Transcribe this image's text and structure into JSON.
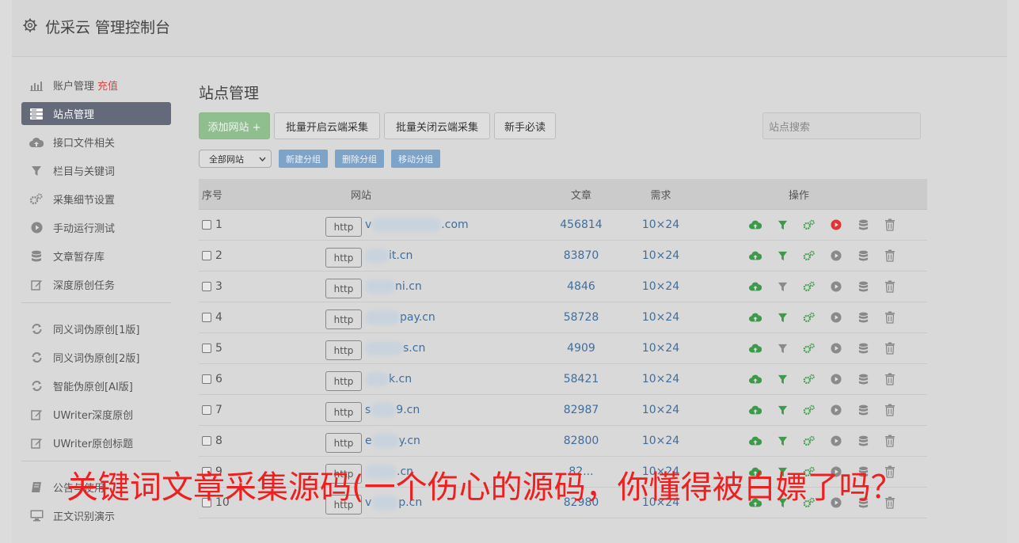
{
  "app": {
    "title": "优采云 管理控制台"
  },
  "sidebar": {
    "items": [
      {
        "label": "账户管理",
        "badge": "充值",
        "icon": "bar-chart-icon"
      },
      {
        "label": "站点管理",
        "icon": "server-icon",
        "active": true
      },
      {
        "label": "接口文件相关",
        "icon": "cloud-upload-icon"
      },
      {
        "label": "栏目与关键词",
        "icon": "filter-icon"
      },
      {
        "label": "采集细节设置",
        "icon": "gears-icon"
      },
      {
        "label": "手动运行测试",
        "icon": "play-circle-icon"
      },
      {
        "label": "文章暂存库",
        "icon": "database-icon"
      },
      {
        "label": "深度原创任务",
        "icon": "edit-icon"
      }
    ],
    "items2": [
      {
        "label": "同义词伪原创[1版]",
        "icon": "refresh-icon"
      },
      {
        "label": "同义词伪原创[2版]",
        "icon": "refresh-icon"
      },
      {
        "label": "智能伪原创[AI版]",
        "icon": "refresh-icon"
      },
      {
        "label": "UWriter深度原创",
        "icon": "edit-icon"
      },
      {
        "label": "UWriter原创标题",
        "icon": "edit-icon"
      }
    ],
    "items3": [
      {
        "label": "公告与使用",
        "icon": "book-icon"
      },
      {
        "label": "正文识别演示",
        "icon": "monitor-icon"
      }
    ]
  },
  "main": {
    "title": "站点管理",
    "buttons": {
      "add_site": "添加网站 +",
      "batch_enable": "批量开启云端采集",
      "batch_disable": "批量关闭云端采集",
      "beginner": "新手必读"
    },
    "search": {
      "placeholder": "站点搜索"
    },
    "group_select": "全部网站",
    "group_buttons": {
      "new": "新建分组",
      "delete": "删除分组",
      "move": "移动分组"
    },
    "table": {
      "headers": {
        "no": "序号",
        "site": "网站",
        "articles": "文章",
        "demand": "需求",
        "ops": "操作"
      },
      "rows": [
        {
          "no": "1",
          "proto": "http",
          "prefix": "v",
          "suffix": ".com",
          "articles": "456814",
          "demand": "10×24",
          "filter_on": true,
          "run_red": true
        },
        {
          "no": "2",
          "proto": "http",
          "prefix": "",
          "suffix": "it.cn",
          "articles": "83870",
          "demand": "10×24",
          "filter_on": true,
          "run_red": false
        },
        {
          "no": "3",
          "proto": "http",
          "prefix": "",
          "suffix": "ni.cn",
          "articles": "4846",
          "demand": "10×24",
          "filter_on": false,
          "run_red": false
        },
        {
          "no": "4",
          "proto": "http",
          "prefix": "",
          "suffix": "pay.cn",
          "articles": "58728",
          "demand": "10×24",
          "filter_on": true,
          "run_red": false
        },
        {
          "no": "5",
          "proto": "http",
          "prefix": "",
          "suffix": "s.cn",
          "articles": "4909",
          "demand": "10×24",
          "filter_on": false,
          "run_red": false
        },
        {
          "no": "6",
          "proto": "http",
          "prefix": "",
          "suffix": "k.cn",
          "articles": "58421",
          "demand": "10×24",
          "filter_on": true,
          "run_red": false
        },
        {
          "no": "7",
          "proto": "http",
          "prefix": "s",
          "suffix": "9.cn",
          "articles": "82987",
          "demand": "10×24",
          "filter_on": true,
          "run_red": false
        },
        {
          "no": "8",
          "proto": "http",
          "prefix": "e",
          "suffix": "y.cn",
          "articles": "82800",
          "demand": "10×24",
          "filter_on": true,
          "run_red": false
        },
        {
          "no": "9",
          "proto": "http",
          "prefix": "",
          "suffix": ".cn",
          "articles": "82...",
          "demand": "10×24",
          "filter_on": true,
          "run_red": false
        },
        {
          "no": "10",
          "proto": "http",
          "prefix": "v",
          "suffix": "p.cn",
          "articles": "82980",
          "demand": "10×24",
          "filter_on": true,
          "run_red": false
        }
      ]
    }
  },
  "overlay": {
    "text": "关键词文章采集源码(一个伤心的源码，你懂得被白嫖了吗？"
  },
  "colors": {
    "green": "#3d9a4a",
    "red": "#e03434",
    "link": "#3f6e9e",
    "active_nav": "#646a7a"
  }
}
